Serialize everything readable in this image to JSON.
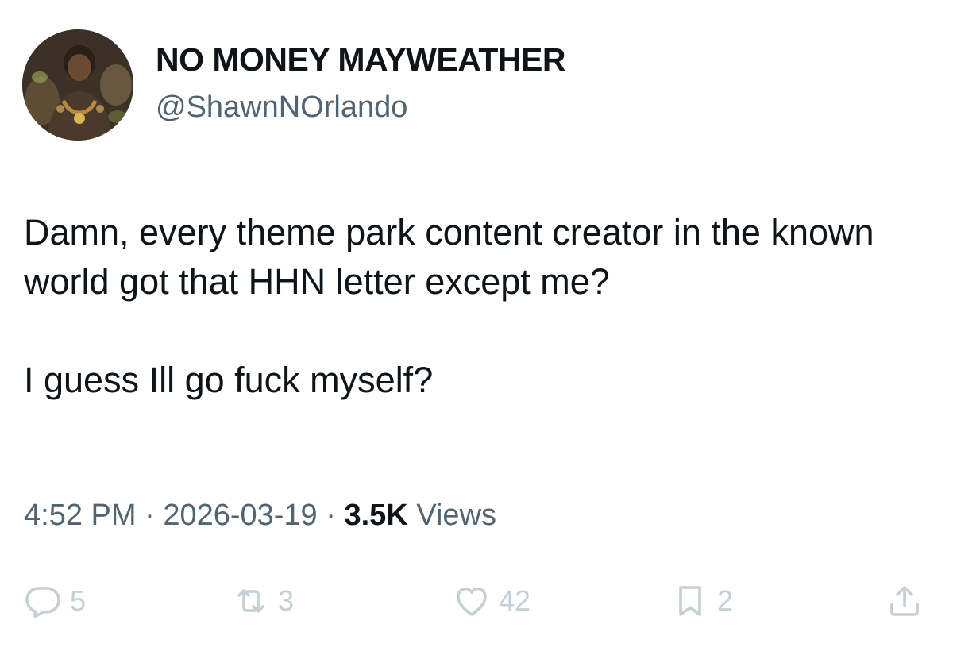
{
  "author": {
    "display_name": "NO MONEY MAYWEATHER",
    "handle": "@ShawnNOrlando",
    "avatar_icon": "profile-photo"
  },
  "tweet": {
    "paragraphs": [
      "Damn, every theme park content creator in the known world got that HHN letter except me?",
      "I guess Ill go fuck myself?"
    ]
  },
  "meta": {
    "time": "4:52 PM",
    "separator": "·",
    "date": "2026-03-19",
    "views_count": "3.5K",
    "views_label": "Views"
  },
  "actions": {
    "reply": {
      "icon": "reply-icon",
      "count": "5"
    },
    "retweet": {
      "icon": "retweet-icon",
      "count": "3"
    },
    "like": {
      "icon": "heart-icon",
      "count": "42"
    },
    "bookmark": {
      "icon": "bookmark-icon",
      "count": "2"
    },
    "share": {
      "icon": "share-icon"
    }
  },
  "colors": {
    "text_primary": "#0f1419",
    "text_secondary": "#536471",
    "action_gray": "#c4cfd6",
    "background": "#ffffff"
  }
}
